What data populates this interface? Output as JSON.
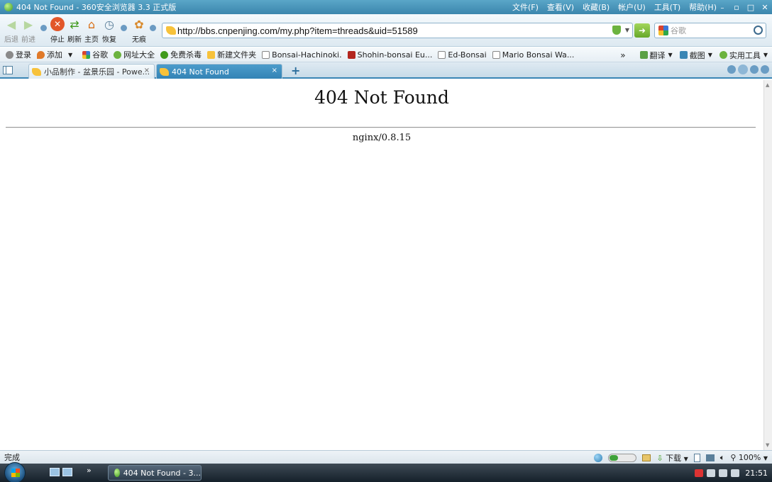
{
  "window": {
    "title": "404 Not Found - 360安全浏览器 3.3 正式版",
    "menus": [
      "文件(F)",
      "查看(V)",
      "收藏(B)",
      "帐户(U)",
      "工具(T)",
      "帮助(H)"
    ],
    "controls": [
      "﹣",
      "▫",
      "□",
      "✕"
    ]
  },
  "toolbar": {
    "back": "后退",
    "forward": "前进",
    "stop": "停止",
    "refresh": "刷新",
    "home": "主页",
    "restore": "恢复",
    "incognito": "无痕",
    "url": "http://bbs.cnpenjing.com/my.php?item=threads&uid=51589",
    "search_placeholder": "谷歌"
  },
  "favorites": {
    "items": [
      {
        "label": "登录",
        "color": "#8a8a8a"
      },
      {
        "label": "添加",
        "color": "#e07a2a"
      },
      {
        "label": "谷歌",
        "color": "#3a78d8"
      },
      {
        "label": "网址大全",
        "color": "#6cb33f"
      },
      {
        "label": "免费杀毒",
        "color": "#3f9a1c"
      },
      {
        "label": "新建文件夹",
        "color": "#f7c23b"
      },
      {
        "label": "Bonsai-Hachinoki.",
        "color": "#c7ccd2"
      },
      {
        "label": "Shohin-bonsai Eu...",
        "color": "#b3261e"
      },
      {
        "label": "Ed-Bonsai",
        "color": "#c7ccd2"
      },
      {
        "label": "Mario Bonsai Wa...",
        "color": "#c7ccd2"
      }
    ],
    "more": "»",
    "right": [
      "翻译",
      "截图",
      "实用工具"
    ]
  },
  "tabs": [
    {
      "label": "小品制作 - 盆景乐园 - Powe...",
      "close": "×"
    },
    {
      "label": "404 Not Found",
      "close": "×"
    }
  ],
  "new_tab": "+",
  "page": {
    "heading": "404 Not Found",
    "server": "nginx/0.8.15"
  },
  "status": {
    "text": "完成",
    "download": "下载",
    "zoom": "100%"
  },
  "taskbar": {
    "chevron": "»",
    "task": "404 Not Found - 3...",
    "clock": "21:51"
  }
}
